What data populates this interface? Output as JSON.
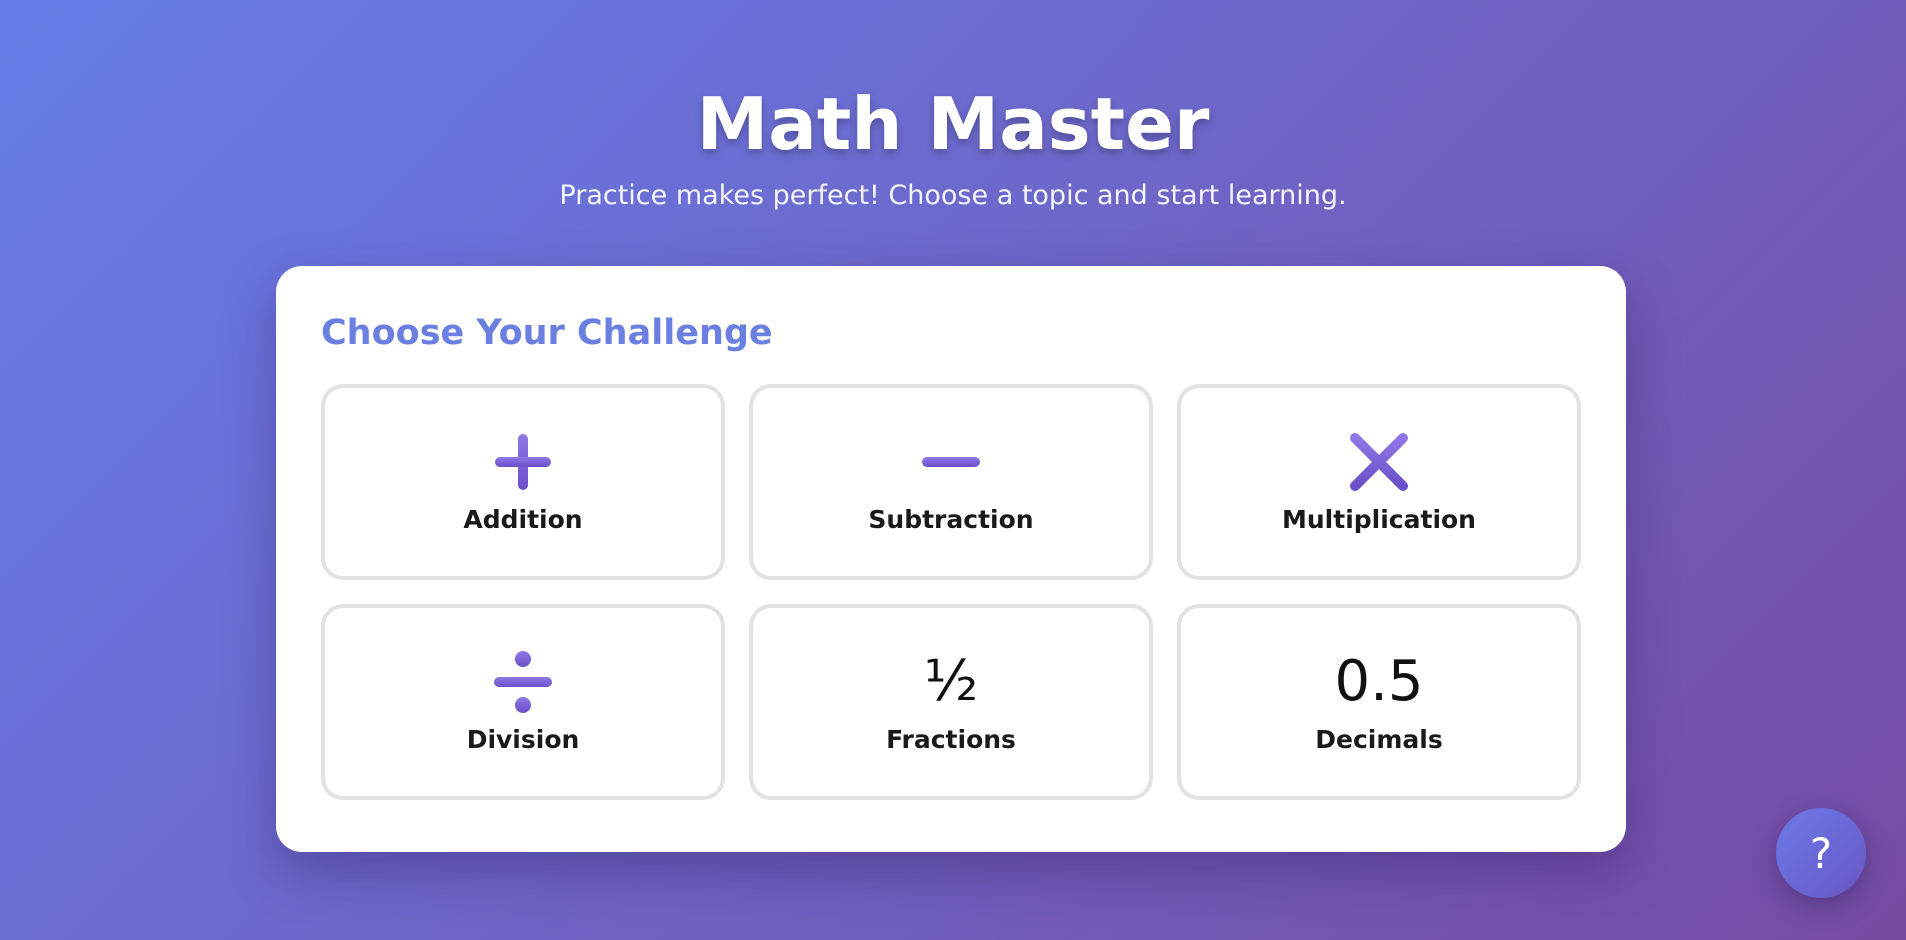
{
  "header": {
    "title": "Math Master",
    "subtitle": "Practice makes perfect! Choose a topic and start learning."
  },
  "panel": {
    "title": "Choose Your Challenge",
    "topics": [
      {
        "label": "Addition",
        "icon": "plus-icon"
      },
      {
        "label": "Subtraction",
        "icon": "minus-icon"
      },
      {
        "label": "Multiplication",
        "icon": "multiply-icon"
      },
      {
        "label": "Division",
        "icon": "divide-icon"
      },
      {
        "label": "Fractions",
        "icon_text": "½"
      },
      {
        "label": "Decimals",
        "icon_text": "0.5"
      }
    ]
  },
  "help": {
    "label": "?"
  },
  "colors": {
    "gradient_start": "#667eea",
    "gradient_end": "#764ba2",
    "accent": "#6a7fe0",
    "icon_purple": "#7b5fd6"
  }
}
